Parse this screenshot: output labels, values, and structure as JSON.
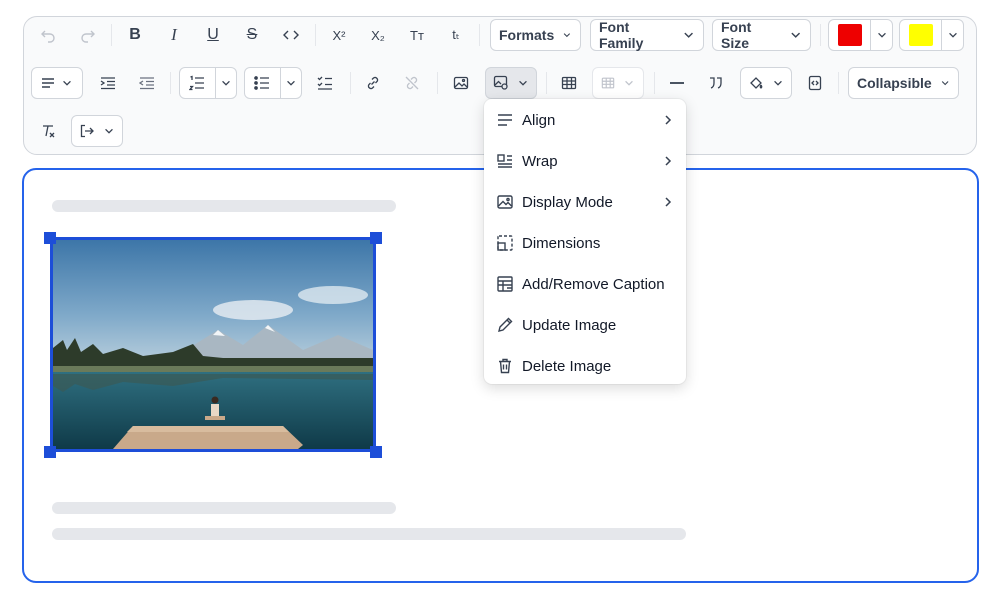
{
  "toolbar": {
    "formats_label": "Formats",
    "font_family_label": "Font Family",
    "font_size_label": "Font Size",
    "collapsible_label": "Collapsible",
    "superscript_glyph": "X²",
    "subscript_glyph": "X₂",
    "uppercase_glyph": "Tт",
    "lowercase_glyph": "tₜ",
    "text_color": "#ee0000",
    "highlight_color": "#ffff00"
  },
  "image_menu": {
    "items": [
      {
        "label": "Align",
        "icon": "align-icon",
        "submenu": true
      },
      {
        "label": "Wrap",
        "icon": "wrap-icon",
        "submenu": true
      },
      {
        "label": "Display Mode",
        "icon": "image-icon",
        "submenu": true
      },
      {
        "label": "Dimensions",
        "icon": "dimensions-icon",
        "submenu": false
      },
      {
        "label": "Add/Remove Caption",
        "icon": "caption-icon",
        "submenu": false
      },
      {
        "label": "Update Image",
        "icon": "pencil-icon",
        "submenu": false
      },
      {
        "label": "Delete Image",
        "icon": "trash-icon",
        "submenu": false
      }
    ]
  },
  "editor": {
    "image_icon": "lake-photo"
  }
}
